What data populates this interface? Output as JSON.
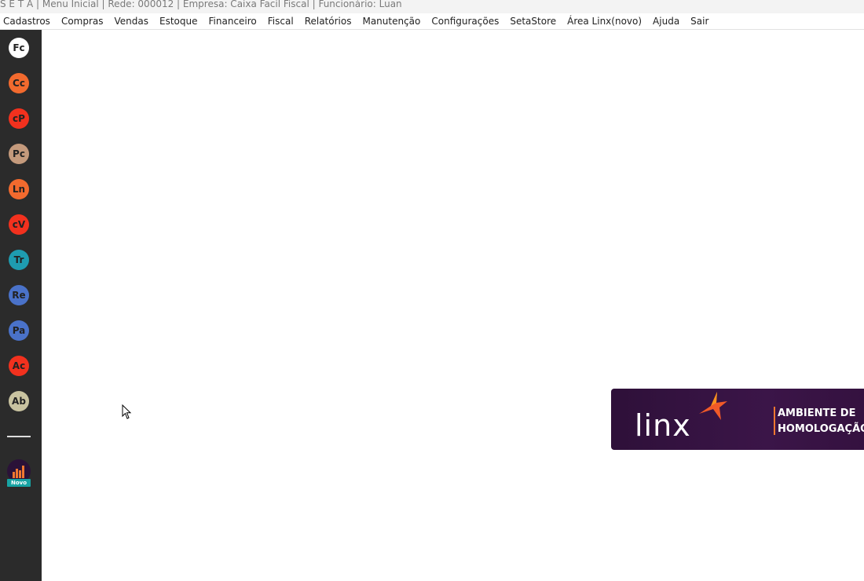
{
  "window": {
    "title": "S E T A | Menu Inicial | Rede: 000012 | Empresa: Caixa  Facil Fiscal | Funcionário: Luan"
  },
  "menu": [
    {
      "label": "Cadastros"
    },
    {
      "label": "Compras"
    },
    {
      "label": "Vendas"
    },
    {
      "label": "Estoque"
    },
    {
      "label": "Financeiro"
    },
    {
      "label": "Fiscal"
    },
    {
      "label": "Relatórios"
    },
    {
      "label": "Manutenção"
    },
    {
      "label": "Configurações"
    },
    {
      "label": "SetaStore"
    },
    {
      "label": "Área Linx(novo)"
    },
    {
      "label": "Ajuda"
    },
    {
      "label": "Sair"
    }
  ],
  "sidebar": {
    "items": [
      {
        "label": "Fc",
        "color": "#ffffff",
        "icon": "fc-circle-icon"
      },
      {
        "label": "Cc",
        "color": "#f26a2e",
        "icon": "cc-circle-icon"
      },
      {
        "label": "cP",
        "color": "#f2311e",
        "icon": "cp-circle-icon"
      },
      {
        "label": "Pc",
        "color": "#c49a7c",
        "icon": "pc-circle-icon"
      },
      {
        "label": "Ln",
        "color": "#f26a2e",
        "icon": "ln-circle-icon"
      },
      {
        "label": "cV",
        "color": "#f2311e",
        "icon": "cv-circle-icon"
      },
      {
        "label": "Tr",
        "color": "#1e9cb0",
        "icon": "tr-circle-icon"
      },
      {
        "label": "Re",
        "color": "#4a72c9",
        "icon": "re-circle-icon"
      },
      {
        "label": "Pa",
        "color": "#4a72c9",
        "icon": "pa-circle-icon"
      },
      {
        "label": "Ac",
        "color": "#f2311e",
        "icon": "ac-circle-icon"
      },
      {
        "label": "Ab",
        "color": "#c9c3a0",
        "icon": "ab-circle-icon"
      }
    ],
    "novo": {
      "label": "Novo",
      "icon": "bar-chart-icon",
      "badge_color": "#17a3a3"
    }
  },
  "banner": {
    "logo": "linx",
    "line1": "AMBIENTE DE",
    "line2": "HOMOLOGAÇÃO",
    "accent": "#f07830"
  }
}
